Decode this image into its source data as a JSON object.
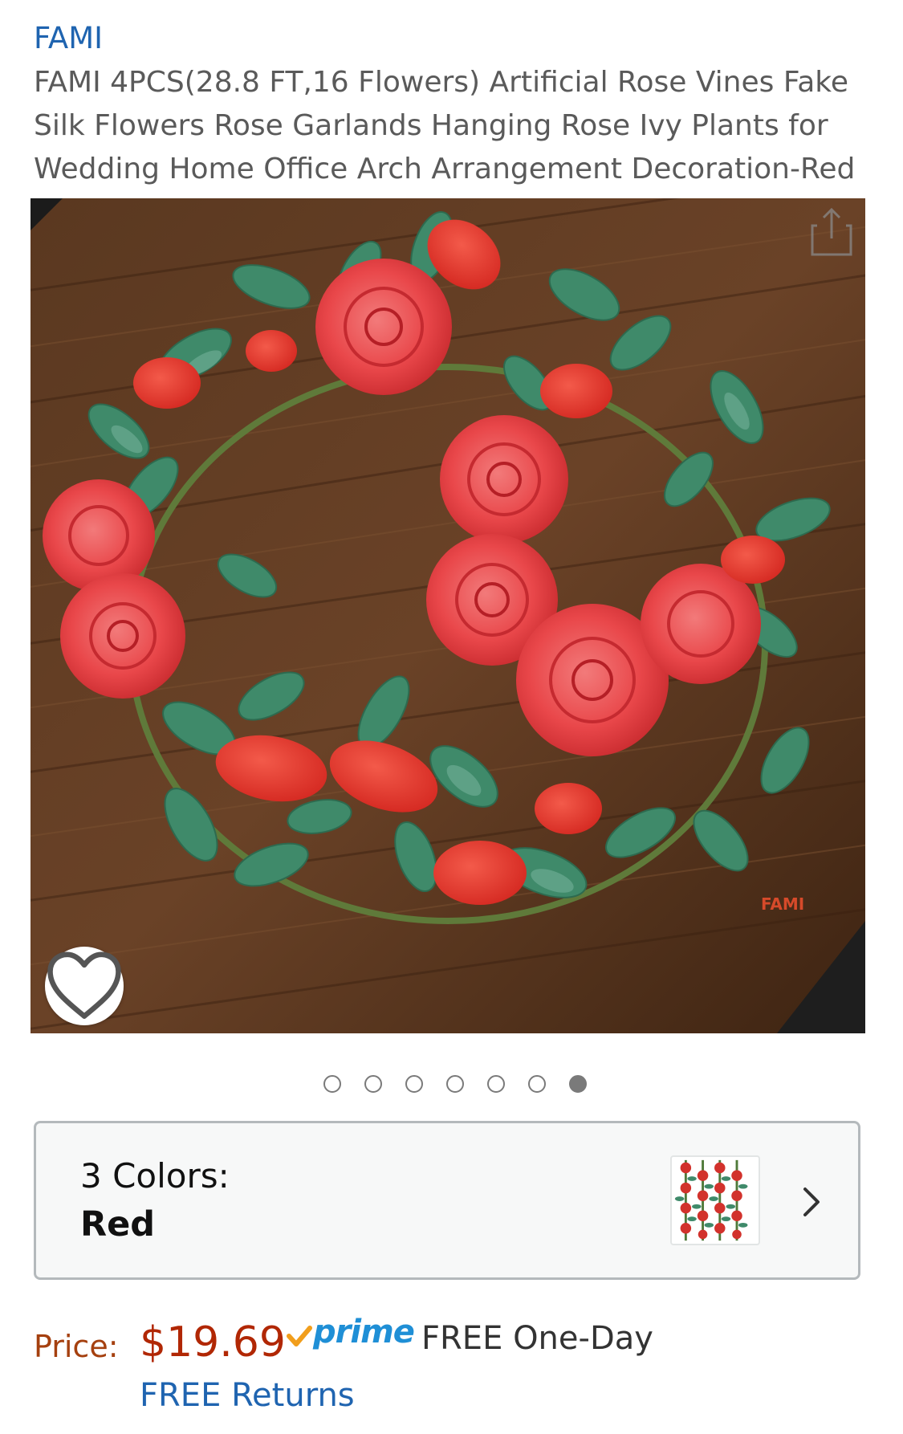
{
  "brand": {
    "name": "FAMI"
  },
  "product": {
    "title": "FAMI 4PCS(28.8 FT,16 Flowers) Artificial Rose Vines Fake Silk Flowers Rose Garlands Hanging Rose Ivy Plants for Wedding Home Office Arch Arrangement Decoration-Red"
  },
  "image": {
    "watermark": "FAMI",
    "carousel": {
      "total_images": 7,
      "active_index": 7
    }
  },
  "variation": {
    "label": "3 Colors:",
    "selected": "Red"
  },
  "pricing": {
    "label": "Price:",
    "amount": "$19.69",
    "prime": "prime",
    "delivery": "FREE One-Day",
    "returns": "FREE Returns"
  },
  "colors": {
    "link": "#1f64b0",
    "price": "#b12704",
    "price_label": "#a5400f",
    "prime": "#1f8fd6",
    "prime_check": "#f19e1c"
  },
  "icons": {
    "share": "share-icon",
    "favorite": "heart-icon",
    "chevron": "chevron-right-icon",
    "prime_check": "checkmark-icon"
  }
}
